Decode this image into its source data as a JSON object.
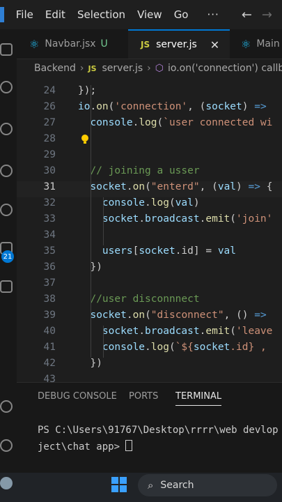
{
  "menu": [
    "File",
    "Edit",
    "Selection",
    "View",
    "Go"
  ],
  "menu_more": "···",
  "nav": {
    "back": "←",
    "forward": "→"
  },
  "tabs": [
    {
      "label": "Navbar.jsx",
      "status": "U",
      "icon": "react-icon"
    },
    {
      "label": "server.js",
      "icon": "js-icon",
      "close": "✕",
      "active": true
    },
    {
      "label": "Main",
      "icon": "react-icon"
    }
  ],
  "js_badge": "JS",
  "breadcrumb": {
    "folder": "Backend",
    "file": "server.js",
    "symbol": "io.on('connection') callb"
  },
  "editor": {
    "lines": [
      {
        "n": "24",
        "code": "});"
      },
      {
        "n": "26",
        "code": "io.on('connection', (socket) =>"
      },
      {
        "n": "27",
        "code": "  console.log(`user connected wi"
      },
      {
        "n": "28",
        "code": ""
      },
      {
        "n": "29",
        "code": ""
      },
      {
        "n": "30",
        "code": "  // joining a usser"
      },
      {
        "n": "31",
        "code": "  socket.on(\"enterd\", (val) => {"
      },
      {
        "n": "32",
        "code": "    console.log(val)"
      },
      {
        "n": "33",
        "code": "    socket.broadcast.emit('join'"
      },
      {
        "n": "34",
        "code": ""
      },
      {
        "n": "35",
        "code": "    users[socket.id] = val"
      },
      {
        "n": "36",
        "code": "  })"
      },
      {
        "n": "37",
        "code": ""
      },
      {
        "n": "38",
        "code": "  //user disconnnect"
      },
      {
        "n": "39",
        "code": "  socket.on(\"disconnect\", () =>"
      },
      {
        "n": "40",
        "code": "    socket.broadcast.emit('leave"
      },
      {
        "n": "41",
        "code": "    console.log(`${socket.id} ,"
      },
      {
        "n": "42",
        "code": "  })"
      },
      {
        "n": "43",
        "code": ""
      }
    ]
  },
  "panel": {
    "tabs": [
      "DEBUG CONSOLE",
      "PORTS",
      "TERMINAL"
    ],
    "active": "TERMINAL"
  },
  "terminal": {
    "line1": "PS C:\\Users\\91767\\Desktop\\rrrr\\web devlop",
    "line2": "ject\\chat app> "
  },
  "activity_badge": "21",
  "taskbar": {
    "search_label": "Search"
  },
  "colors": {
    "accent": "#0078d4",
    "badge": "#0078d4"
  }
}
